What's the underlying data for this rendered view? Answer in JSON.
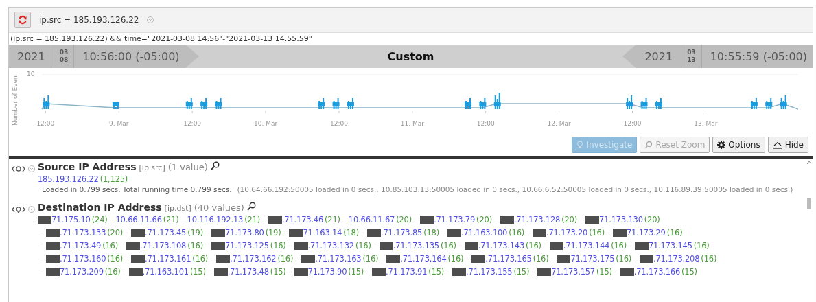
{
  "query_bar": {
    "query": "ip.src = 185.193.126.22"
  },
  "expression": "(ip.src = 185.193.126.22) && time=\"2021-03-08 14:56\"-\"2021-03-13 14.55.59\"",
  "time_range": {
    "start": {
      "year": "2021",
      "month": "03",
      "day": "08",
      "time": "10:56:00 (-05:00)"
    },
    "label": "Custom",
    "end": {
      "year": "2021",
      "month": "03",
      "day": "13",
      "time": "10:55:59 (-05:00)"
    }
  },
  "timeline": {
    "ylabel": "Number of Even",
    "yticks": [
      "10"
    ],
    "xticks": [
      "12:00",
      "9. Mar",
      "12:00",
      "10. Mar",
      "12:00",
      "11. Mar",
      "12:00",
      "12. Mar",
      "12:00",
      "13. Mar"
    ]
  },
  "buttons": [
    {
      "label": "Investigate",
      "kind": "investigate",
      "disabled": true
    },
    {
      "label": "Reset Zoom",
      "kind": "zoom",
      "disabled": true
    },
    {
      "label": "Options",
      "kind": "options",
      "disabled": false
    },
    {
      "label": "Hide",
      "kind": "hide",
      "disabled": false
    }
  ],
  "sections": [
    {
      "title": "Source IP Address",
      "field": "[ip.src]",
      "count": "(1 value)",
      "rows": [
        [
          {
            "value": "185.193.126.22",
            "count": "(1,125)",
            "redacted": false
          }
        ]
      ],
      "timing": "Loaded in 0.799 secs. Total running time 0.799 secs.",
      "detail": "(10.64.66.192:50005 loaded in 0 secs., 10.85.103.13:50005 loaded in 0 secs., 10.66.6.52:50005 loaded in 0 secs., 10.116.89.39:50005 loaded in 0 secs.)"
    },
    {
      "title": "Destination IP Address",
      "field": "[ip.dst]",
      "count": "(40 values)",
      "separator": "-",
      "rows": [
        [
          {
            "value": "71.175.10",
            "count": "(24)",
            "redacted": true
          },
          {
            "value": "10.66.11.66",
            "count": "(21)",
            "redacted": false
          },
          {
            "value": "10.116.192.13",
            "count": "(21)",
            "redacted": false
          },
          {
            "value": ".71.173.46",
            "count": "(21)",
            "redacted": true
          },
          {
            "value": "10.66.11.67",
            "count": "(20)",
            "redacted": false
          },
          {
            "value": ".71.173.79",
            "count": "(20)",
            "redacted": true
          },
          {
            "value": ".71.173.128",
            "count": "(20)",
            "redacted": true
          },
          {
            "value": "71.173.130",
            "count": "(20)",
            "redacted": true
          }
        ],
        [
          {
            "value": ".71.173.133",
            "count": "(20)",
            "redacted": true
          },
          {
            "value": ".71.173.45",
            "count": "(19)",
            "redacted": true
          },
          {
            "value": "71.173.80",
            "count": "(19)",
            "redacted": true
          },
          {
            "value": "71.163.14",
            "count": "(18)",
            "redacted": true
          },
          {
            "value": ".71.173.85",
            "count": "(18)",
            "redacted": true
          },
          {
            "value": ".71.163.100",
            "count": "(16)",
            "redacted": true
          },
          {
            "value": ".71.173.20",
            "count": "(16)",
            "redacted": true
          },
          {
            "value": "71.173.29",
            "count": "(16)",
            "redacted": true
          }
        ],
        [
          {
            "value": ".71.173.49",
            "count": "(16)",
            "redacted": true
          },
          {
            "value": ".71.173.108",
            "count": "(16)",
            "redacted": true
          },
          {
            "value": "71.173.125",
            "count": "(16)",
            "redacted": true
          },
          {
            "value": ".71.173.132",
            "count": "(16)",
            "redacted": true
          },
          {
            "value": ".71.173.135",
            "count": "(16)",
            "redacted": true
          },
          {
            "value": ".71.173.143",
            "count": "(16)",
            "redacted": true
          },
          {
            "value": ".71.173.144",
            "count": "(16)",
            "redacted": true
          },
          {
            "value": "71.173.145",
            "count": "(16)",
            "redacted": true
          }
        ],
        [
          {
            "value": ".71.173.160",
            "count": "(16)",
            "redacted": true
          },
          {
            "value": ".71.173.161",
            "count": "(16)",
            "redacted": true
          },
          {
            "value": ".71.173.162",
            "count": "(16)",
            "redacted": true
          },
          {
            "value": ".71.173.163",
            "count": "(16)",
            "redacted": true
          },
          {
            "value": ".71.173.164",
            "count": "(16)",
            "redacted": true
          },
          {
            "value": ".71.173.165",
            "count": "(16)",
            "redacted": true
          },
          {
            "value": "71.173.175",
            "count": "(16)",
            "redacted": true
          },
          {
            "value": ".71.173.208",
            "count": "(16)",
            "redacted": true
          }
        ],
        [
          {
            "value": "71.173.209",
            "count": "(16)",
            "redacted": true
          },
          {
            "value": ".71.163.101",
            "count": "(15)",
            "redacted": true
          },
          {
            "value": ".71.173.48",
            "count": "(15)",
            "redacted": true
          },
          {
            "value": "71.173.90",
            "count": "(15)",
            "redacted": true
          },
          {
            "value": ".71.173.91",
            "count": "(15)",
            "redacted": true
          },
          {
            "value": ".71.173.155",
            "count": "(15)",
            "redacted": true
          },
          {
            "value": "71.173.157",
            "count": "(15)",
            "redacted": true
          },
          {
            "value": ".71.173.166",
            "count": "(15)",
            "redacted": true
          }
        ]
      ]
    }
  ]
}
